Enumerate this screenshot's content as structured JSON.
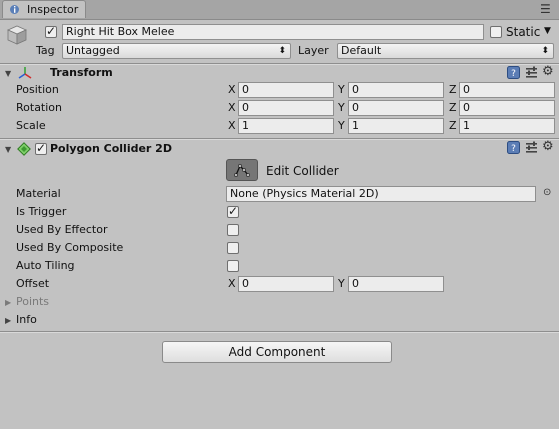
{
  "window": {
    "tab_label": "Inspector"
  },
  "gameobject": {
    "name": "Right Hit Box Melee",
    "active": true,
    "static_label": "Static",
    "static_checked": false,
    "tag_label": "Tag",
    "tag_value": "Untagged",
    "layer_label": "Layer",
    "layer_value": "Default"
  },
  "transform": {
    "title": "Transform",
    "rows": [
      {
        "label": "Position",
        "x": "0",
        "y": "0",
        "z": "0"
      },
      {
        "label": "Rotation",
        "x": "0",
        "y": "0",
        "z": "0"
      },
      {
        "label": "Scale",
        "x": "1",
        "y": "1",
        "z": "1"
      }
    ],
    "axis": {
      "x": "X",
      "y": "Y",
      "z": "Z"
    }
  },
  "collider": {
    "title": "Polygon Collider 2D",
    "enabled": true,
    "edit_label": "Edit Collider",
    "material_label": "Material",
    "material_value": "None (Physics Material 2D)",
    "is_trigger_label": "Is Trigger",
    "is_trigger": true,
    "used_by_effector_label": "Used By Effector",
    "used_by_effector": false,
    "used_by_composite_label": "Used By Composite",
    "used_by_composite": false,
    "auto_tiling_label": "Auto Tiling",
    "auto_tiling": false,
    "offset_label": "Offset",
    "offset_x": "0",
    "offset_y": "0",
    "points_label": "Points",
    "info_label": "Info"
  },
  "add_component_label": "Add Component",
  "colors": {
    "background": "#c2c2c2",
    "tabbar": "#a5a5a5",
    "field": "#ececec"
  },
  "icons": [
    "inspector-tab-icon",
    "menu-icon",
    "gameobject-cube-icon",
    "transform-axes-icon",
    "collider-icon",
    "help-icon",
    "preset-icon",
    "gear-icon",
    "edit-collider-icon",
    "object-picker-icon"
  ]
}
